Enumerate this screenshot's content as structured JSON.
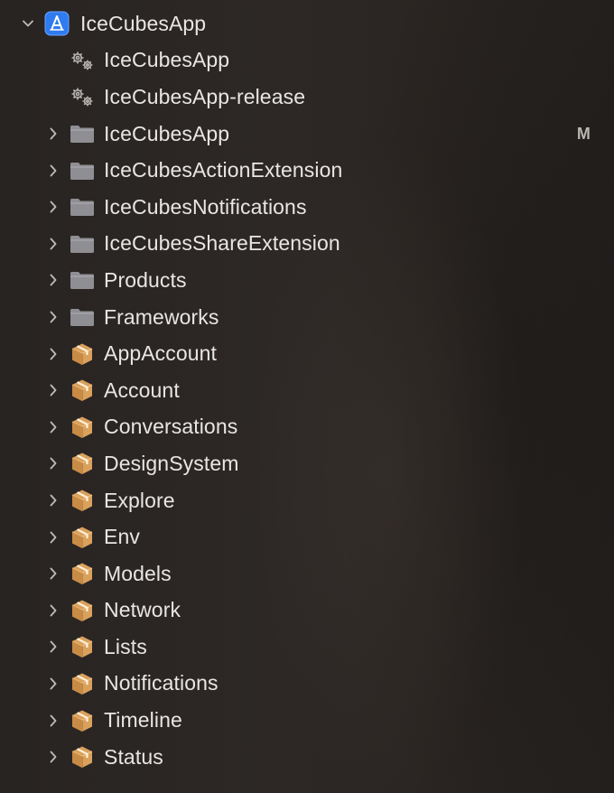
{
  "navigator": {
    "project": {
      "label": "IceCubesApp",
      "icon": "xcode-project-icon",
      "accent": "#3b82f6"
    },
    "items": [
      {
        "label": "IceCubesApp",
        "icon": "target-gears-icon",
        "kind": "target",
        "badge": ""
      },
      {
        "label": "IceCubesApp-release",
        "icon": "target-gears-icon",
        "kind": "target",
        "badge": ""
      },
      {
        "label": "IceCubesApp",
        "icon": "folder-icon",
        "kind": "folder",
        "badge": "M"
      },
      {
        "label": "IceCubesActionExtension",
        "icon": "folder-icon",
        "kind": "folder",
        "badge": ""
      },
      {
        "label": "IceCubesNotifications",
        "icon": "folder-icon",
        "kind": "folder",
        "badge": ""
      },
      {
        "label": "IceCubesShareExtension",
        "icon": "folder-icon",
        "kind": "folder",
        "badge": ""
      },
      {
        "label": "Products",
        "icon": "folder-icon",
        "kind": "folder",
        "badge": ""
      },
      {
        "label": "Frameworks",
        "icon": "folder-icon",
        "kind": "folder",
        "badge": ""
      },
      {
        "label": "AppAccount",
        "icon": "package-icon",
        "kind": "package",
        "badge": ""
      },
      {
        "label": "Account",
        "icon": "package-icon",
        "kind": "package",
        "badge": ""
      },
      {
        "label": "Conversations",
        "icon": "package-icon",
        "kind": "package",
        "badge": ""
      },
      {
        "label": "DesignSystem",
        "icon": "package-icon",
        "kind": "package",
        "badge": ""
      },
      {
        "label": "Explore",
        "icon": "package-icon",
        "kind": "package",
        "badge": ""
      },
      {
        "label": "Env",
        "icon": "package-icon",
        "kind": "package",
        "badge": ""
      },
      {
        "label": "Models",
        "icon": "package-icon",
        "kind": "package",
        "badge": ""
      },
      {
        "label": "Network",
        "icon": "package-icon",
        "kind": "package",
        "badge": ""
      },
      {
        "label": "Lists",
        "icon": "package-icon",
        "kind": "package",
        "badge": ""
      },
      {
        "label": "Notifications",
        "icon": "package-icon",
        "kind": "package",
        "badge": ""
      },
      {
        "label": "Timeline",
        "icon": "package-icon",
        "kind": "package",
        "badge": ""
      },
      {
        "label": "Status",
        "icon": "package-icon",
        "kind": "package",
        "badge": ""
      }
    ]
  },
  "colors": {
    "text": "#e8e6e3",
    "folder": "#8e8e93",
    "package": "#d9a15c"
  }
}
